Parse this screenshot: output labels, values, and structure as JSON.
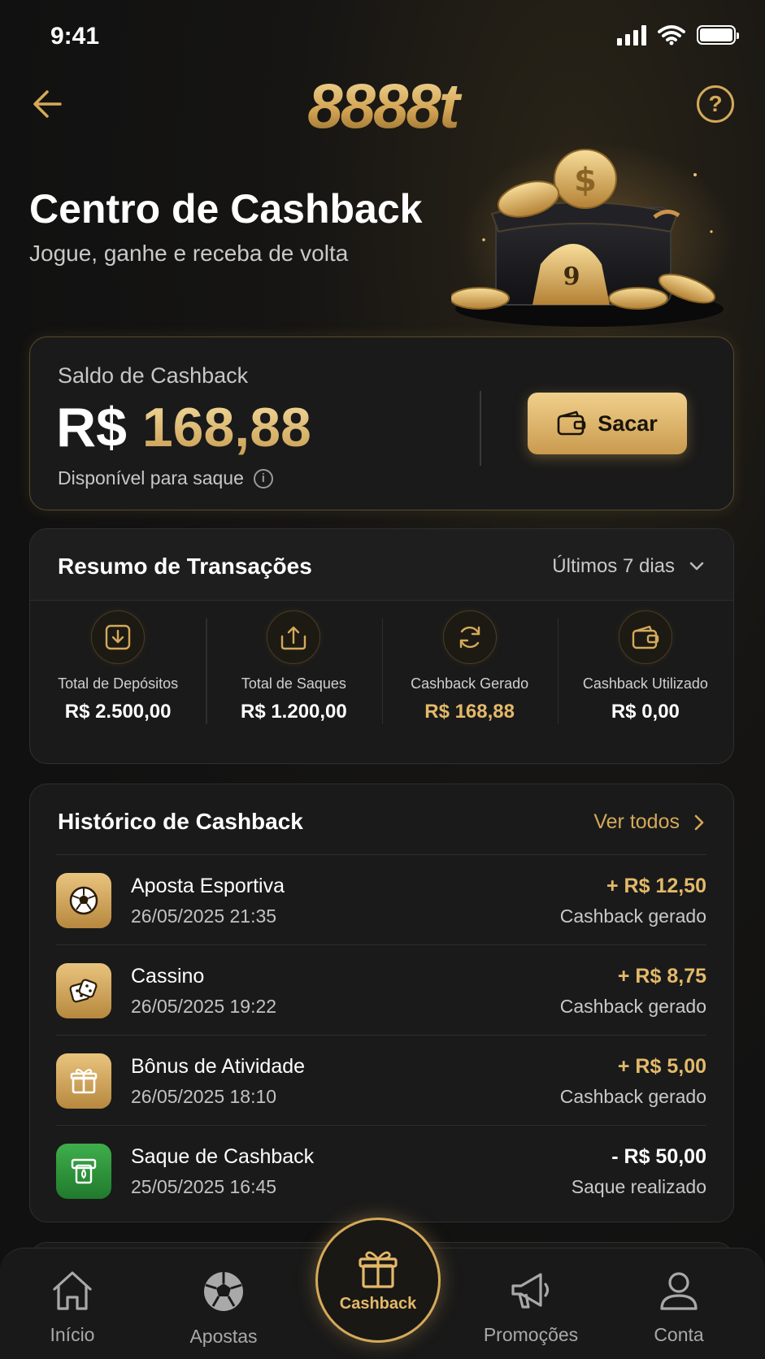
{
  "status_bar": {
    "time": "9:41"
  },
  "header": {
    "logo": "8888t"
  },
  "hero": {
    "title": "Centro de Cashback",
    "subtitle": "Jogue, ganhe e receba de volta"
  },
  "balance": {
    "label": "Saldo de Cashback",
    "currency": "R$",
    "amount": "168,88",
    "note": "Disponível para saque",
    "withdraw_label": "Sacar"
  },
  "summary": {
    "title": "Resumo de Transações",
    "period": "Últimos 7 dias",
    "stats": [
      {
        "label": "Total de Depósitos",
        "value": "R$ 2.500,00",
        "icon": "deposit-icon"
      },
      {
        "label": "Total de Saques",
        "value": "R$ 1.200,00",
        "icon": "withdraw-icon"
      },
      {
        "label": "Cashback Gerado",
        "value": "R$ 168,88",
        "icon": "refresh-icon"
      },
      {
        "label": "Cashback Utilizado",
        "value": "R$ 0,00",
        "icon": "wallet-icon"
      }
    ]
  },
  "history": {
    "title": "Histórico de Cashback",
    "view_all": "Ver todos",
    "items": [
      {
        "name": "Aposta Esportiva",
        "date": "26/05/2025 21:35",
        "amount": "+ R$ 12,50",
        "status": "Cashback gerado",
        "icon": "soccer-ball-icon"
      },
      {
        "name": "Cassino",
        "date": "26/05/2025 19:22",
        "amount": "+ R$ 8,75",
        "status": "Cashback gerado",
        "icon": "dice-icon"
      },
      {
        "name": "Bônus de Atividade",
        "date": "26/05/2025 18:10",
        "amount": "+ R$ 5,00",
        "status": "Cashback gerado",
        "icon": "gift-icon"
      },
      {
        "name": "Saque de Cashback",
        "date": "25/05/2025 16:45",
        "amount": "- R$ 50,00",
        "status": "Saque realizado",
        "icon": "cash-out-icon"
      }
    ]
  },
  "nav": {
    "items": [
      {
        "label": "Início",
        "icon": "home-icon"
      },
      {
        "label": "Apostas",
        "icon": "soccer-ball-icon"
      },
      {
        "label": "Cashback",
        "icon": "gift-icon",
        "active": true
      },
      {
        "label": "Promoções",
        "icon": "megaphone-icon"
      },
      {
        "label": "Conta",
        "icon": "user-icon"
      }
    ]
  },
  "colors": {
    "background": "#121212",
    "card": "#1a1a1a",
    "gold": "#d4a95a",
    "gold_light": "#f1d08c",
    "success_green": "#2f9a3d"
  }
}
